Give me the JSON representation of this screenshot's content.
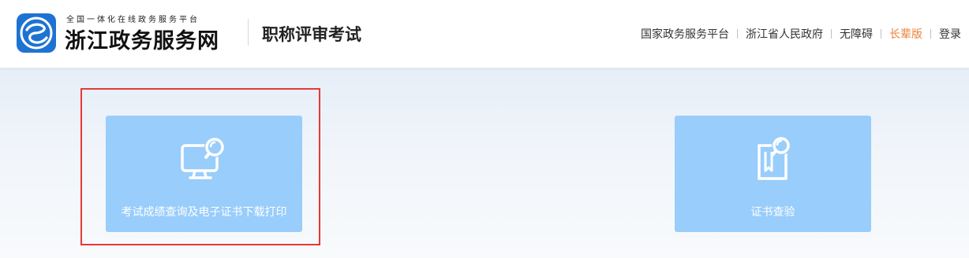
{
  "header": {
    "logo_icon": "zhejiang-gov-logo-icon",
    "tagline": "全国一体化在线政务服务平台",
    "site_name": "浙江政务服务网",
    "section_title": "职称评审考试",
    "nav": [
      {
        "label": "国家政务服务平台"
      },
      {
        "label": "浙江省人民政府"
      },
      {
        "label": "无障碍"
      },
      {
        "label": "长辈版"
      },
      {
        "label": "登录"
      }
    ],
    "accent_color": "#e8823a"
  },
  "cards": [
    {
      "label": "考试成绩查询及电子证书下载打印",
      "icon": "monitor-search-icon"
    },
    {
      "label": "证书查验",
      "icon": "certificate-search-icon"
    }
  ],
  "colors": {
    "card_bg": "#99cdfb",
    "highlight_border": "#e53935",
    "logo_blue": "#1e73d2"
  }
}
